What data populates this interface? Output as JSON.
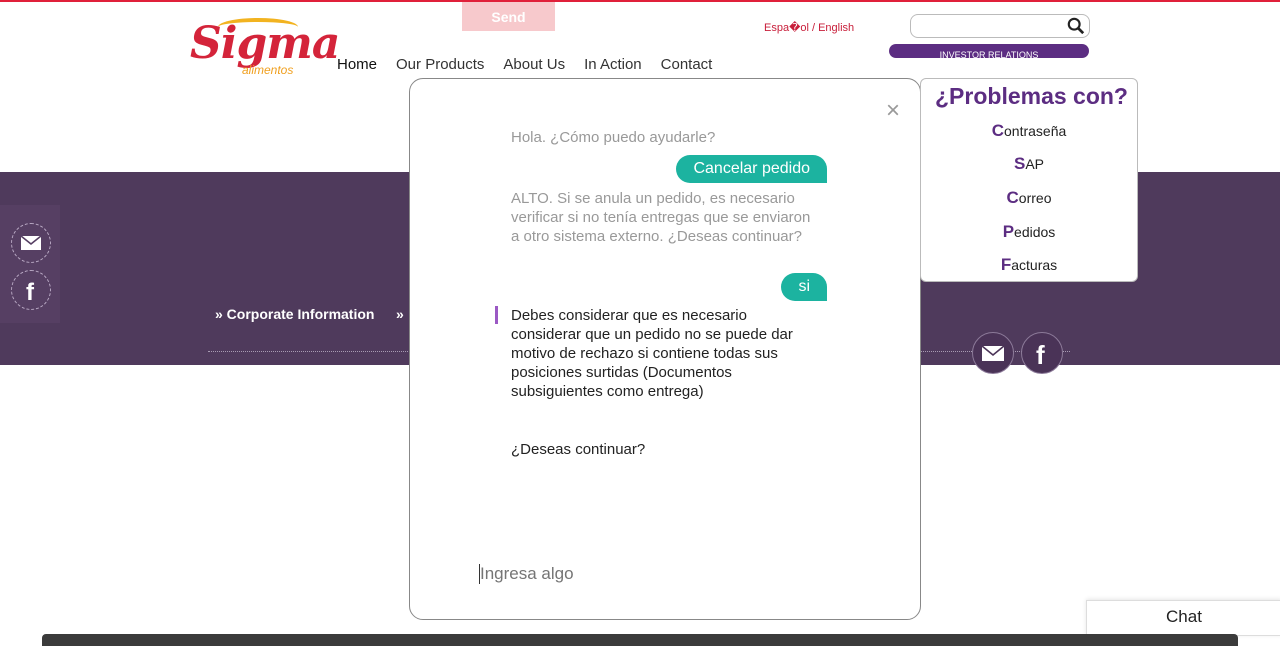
{
  "brand": {
    "name": "Sigma",
    "sub": "alimentos"
  },
  "header": {
    "send_label": "Send",
    "lang": "Espa�ol / English",
    "investor": "INVESTOR RELATIONS",
    "search_placeholder": ""
  },
  "nav": [
    {
      "label": "Home"
    },
    {
      "label": "Our Products"
    },
    {
      "label": "About Us"
    },
    {
      "label": "In Action"
    },
    {
      "label": "Contact"
    }
  ],
  "footer": {
    "corporate": "» Corporate Information",
    "more": "»"
  },
  "chat": {
    "messages": [
      {
        "from": "bot",
        "text": "Hola. ¿Cómo puedo ayudarle?"
      },
      {
        "from": "user",
        "text": "Cancelar pedido"
      },
      {
        "from": "bot",
        "text": "ALTO. Si se anula un pedido, es necesario verificar si no tenía entregas que se enviaron a otro sistema externo. ¿Deseas continuar?"
      },
      {
        "from": "user",
        "text": "si"
      },
      {
        "from": "bot",
        "text": "Debes considerar que es necesario considerar que un pedido no se puede dar motivo de rechazo si contiene todas sus posiciones surtidas (Documentos subsiguientes como entrega)"
      },
      {
        "from": "bot",
        "text": "¿Deseas continuar?"
      }
    ],
    "input_placeholder": "Ingresa algo",
    "close": "×"
  },
  "problems": {
    "title": "¿Problemas con?",
    "items": [
      {
        "first": "C",
        "rest": "ontraseña"
      },
      {
        "first": "S",
        "rest": "AP"
      },
      {
        "first": "C",
        "rest": "orreo"
      },
      {
        "first": "P",
        "rest": "edidos"
      },
      {
        "first": "F",
        "rest": "acturas"
      }
    ]
  },
  "chat_button": "Chat",
  "colors": {
    "brand": "#d4243a",
    "purple": "#5c2d82",
    "band": "#4f3a5c",
    "teal": "#1cb3a0"
  }
}
